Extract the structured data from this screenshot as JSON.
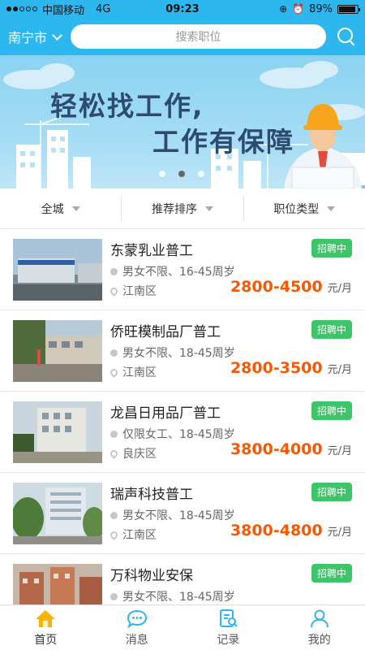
{
  "status": {
    "carrier": "中国移动",
    "network": "4G",
    "time": "09:23",
    "battery": "89%",
    "battery_level": 0.89
  },
  "header": {
    "city": "南宁市",
    "search_placeholder": "搜索职位"
  },
  "banner": {
    "line1": "轻松找工作,",
    "line2": "工作有保障",
    "active_slide": 1,
    "slide_count": 3
  },
  "filters": [
    {
      "label": "全城"
    },
    {
      "label": "推荐排序"
    },
    {
      "label": "职位类型"
    }
  ],
  "jobs": [
    {
      "title": "东蒙乳业普工",
      "badge": "招聘中",
      "requirement": "男女不限、16-45周岁",
      "location": "江南区",
      "salary": "2800-4500",
      "unit": "元/月"
    },
    {
      "title": "侨旺模制品厂普工",
      "badge": "招聘中",
      "requirement": "男女不限、18-45周岁",
      "location": "江南区",
      "salary": "2800-3500",
      "unit": "元/月"
    },
    {
      "title": "龙昌日用品厂普工",
      "badge": "招聘中",
      "requirement": "仅限女工、18-45周岁",
      "location": "良庆区",
      "salary": "3800-4000",
      "unit": "元/月"
    },
    {
      "title": "瑞声科技普工",
      "badge": "招聘中",
      "requirement": "男女不限、18-45周岁",
      "location": "江南区",
      "salary": "3800-4800",
      "unit": "元/月"
    },
    {
      "title": "万科物业安保",
      "badge": "招聘中",
      "requirement": "男女不限、18-45周岁",
      "location": "",
      "salary": "",
      "unit": ""
    }
  ],
  "tabbar": [
    {
      "label": "首页",
      "icon": "home-icon",
      "active": true
    },
    {
      "label": "消息",
      "icon": "message-icon"
    },
    {
      "label": "记录",
      "icon": "record-icon"
    },
    {
      "label": "我的",
      "icon": "profile-icon"
    }
  ],
  "colors": {
    "primary": "#2db7ef",
    "salary": "#f45a06",
    "badge": "#3ec56a",
    "active_tab": "#f5b400"
  }
}
